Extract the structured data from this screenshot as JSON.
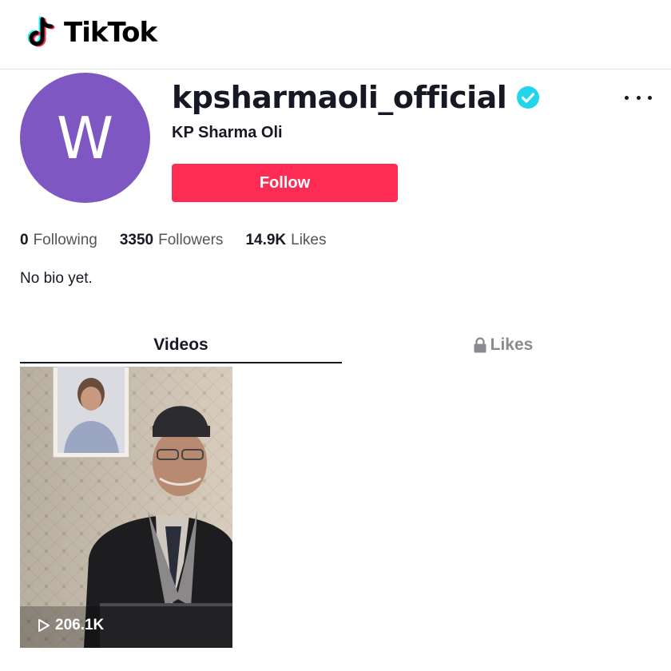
{
  "header": {
    "logo_text": "TikTok"
  },
  "profile": {
    "avatar_letter": "W",
    "avatar_color": "#7e57c2",
    "username": "kpsharmaoli_official",
    "verified": true,
    "display_name": "KP Sharma Oli",
    "follow_label": "Follow",
    "follow_color": "#fe2c55",
    "bio": "No bio yet."
  },
  "stats": [
    {
      "value": "0",
      "label": "Following"
    },
    {
      "value": "3350",
      "label": "Followers"
    },
    {
      "value": "14.9K",
      "label": "Likes"
    }
  ],
  "tabs": [
    {
      "label": "Videos",
      "active": true
    },
    {
      "label": "Likes",
      "locked": true
    }
  ],
  "videos": [
    {
      "views": "206.1K"
    }
  ]
}
